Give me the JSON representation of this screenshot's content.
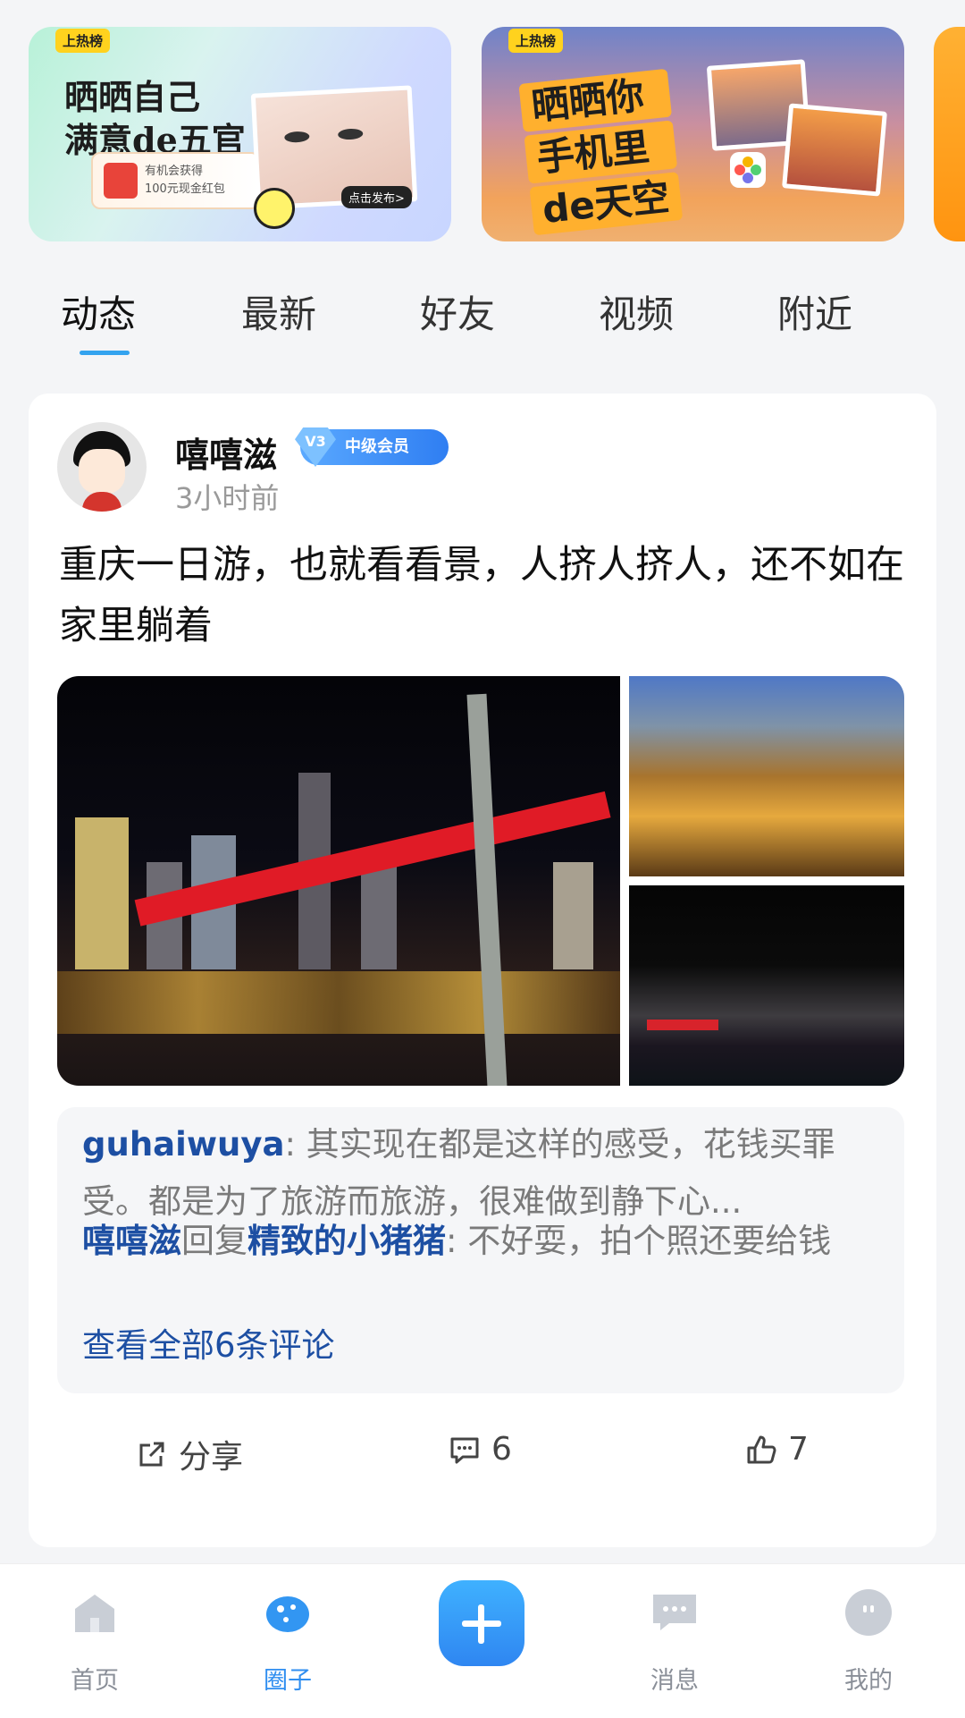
{
  "banners": [
    {
      "tag": "上热榜",
      "title_line1": "晒晒自己",
      "title_line2": "满意de五官",
      "coupon_line1": "有机会获得",
      "coupon_line2": "100元现金红包",
      "cta": "点击发布>"
    },
    {
      "tag": "上热榜",
      "title_line1": "晒晒你",
      "title_line2": "手机里",
      "title_line3": "de天空"
    }
  ],
  "tabs": [
    "动态",
    "最新",
    "好友",
    "视频",
    "附近"
  ],
  "active_tab": "动态",
  "post": {
    "username": "嘻嘻滋",
    "badge_level": "V3",
    "badge_text": "中级会员",
    "time": "3小时前",
    "text": "重庆一日游，也就看看景，人挤人挤人，还不如在家里躺着",
    "comments": [
      {
        "author": "guhaiwuya",
        "separator": ":",
        "text": "  其实现在都是这样的感受，花钱买罪受。都是为了旅游而旅游，很难做到静下心..."
      },
      {
        "author": "嘻嘻滋",
        "reply_word": "回复",
        "reply_to": "精致的小猪猪",
        "separator": ":",
        "text": " 不好耍，拍个照还要给钱"
      }
    ],
    "view_all": "查看全部6条评论",
    "share_label": "分享",
    "comment_count": "6",
    "like_count": "7"
  },
  "nav": {
    "items": [
      {
        "label": "首页",
        "icon": "home-icon"
      },
      {
        "label": "圈子",
        "icon": "circle-icon"
      },
      {
        "label": "消息",
        "icon": "message-icon"
      },
      {
        "label": "我的",
        "icon": "profile-icon"
      }
    ],
    "active": "圈子",
    "add_icon": "plus-icon"
  },
  "colors": {
    "accent": "#2f8ef0",
    "link": "#1d4fa3",
    "tab_indicator": "#33a3ef"
  }
}
